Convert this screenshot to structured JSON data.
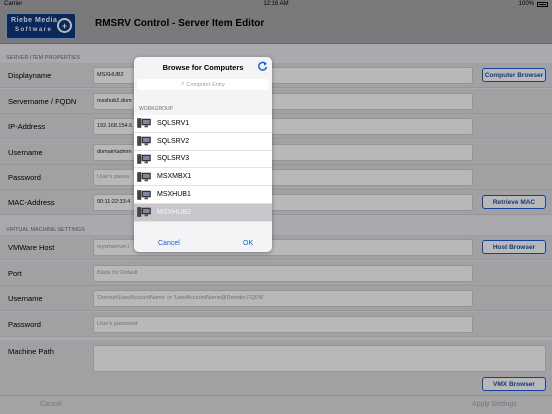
{
  "statusbar": {
    "carrier": "Carrier",
    "time": "12:16 AM",
    "battery": "100%"
  },
  "nav": {
    "logo_line1": "Riebe Media",
    "logo_line2": "Software",
    "title": "RMSRV Control - Server Item Editor"
  },
  "sections": {
    "server": "SERVER ITEM PROPERTIES",
    "vm": "VIRTUAL MACHINE SETTINGS"
  },
  "fields": {
    "displayname": {
      "label": "Displayname",
      "value": "MSXHUB2"
    },
    "servername": {
      "label": "Servername / FQDN",
      "value": "msxhub2.dom"
    },
    "ip": {
      "label": "IP-Address",
      "value": "192.168.154.6"
    },
    "username": {
      "label": "Username",
      "value": "domain\\admin"
    },
    "password": {
      "label": "Password",
      "placeholder": "User's passw"
    },
    "mac": {
      "label": "MAC-Address",
      "value": "00:11:22:33:4"
    },
    "vmhost": {
      "label": "VMWare Host",
      "placeholder": "myvmserver.l"
    },
    "port": {
      "label": "Port",
      "placeholder": "Blank for Default"
    },
    "vmusername": {
      "label": "Username",
      "placeholder": "'Domain\\UserAccountName' or 'UserAccountName@Domain.FQDN'"
    },
    "vmpassword": {
      "label": "Password",
      "placeholder": "User's password"
    },
    "machinepath": {
      "label": "Machine Path"
    }
  },
  "buttons": {
    "computer_browser": "Computer Browser",
    "retrieve_mac": "Retrieve MAC",
    "host_browser": "Host Browser",
    "vmx_browser": "VMX Browser"
  },
  "bottombar": {
    "cancel": "Cancel",
    "apply": "Apply Settings"
  },
  "popover": {
    "title": "Browse for Computers",
    "search_placeholder": "Computer Entry",
    "group": "WORKGROUP",
    "items": [
      "SQLSRV1",
      "SQLSRV2",
      "SQLSRV3",
      "MSXMBX1",
      "MSXHUB1",
      "MSXHUB2"
    ],
    "selected_index": 5,
    "cancel": "Cancel",
    "ok": "OK"
  },
  "colors": {
    "accent": "#1a5cd6",
    "navbar": "#a9a9ad",
    "selection": "#c6c6cb"
  },
  "icons": {
    "refresh": "refresh-icon",
    "search": "magnifier-icon",
    "computer": "computer-icon",
    "battery": "battery-icon",
    "logo": "logo-circle-icon"
  }
}
